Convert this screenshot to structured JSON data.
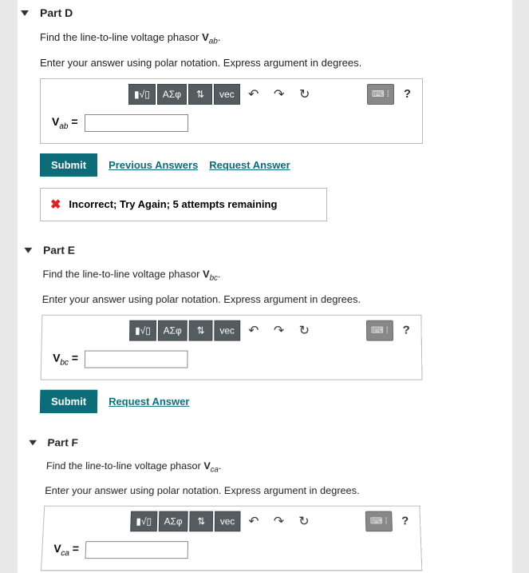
{
  "parts": {
    "d": {
      "title": "Part D",
      "prompt_pre": "Find the line-to-line voltage phasor ",
      "var_bold": "V",
      "var_sub": "ab",
      "prompt_post": ".",
      "instruction": "Enter your answer using polar notation. Express argument in degrees.",
      "label_pre": "V",
      "label_sub": "ab",
      "eq": " =",
      "submit": "Submit",
      "prev": "Previous Answers",
      "req": "Request Answer",
      "feedback": "Incorrect; Try Again; 5 attempts remaining"
    },
    "e": {
      "title": "Part E",
      "prompt_pre": "Find the line-to-line voltage phasor ",
      "var_bold": "V",
      "var_sub": "bc",
      "prompt_post": ".",
      "instruction": "Enter your answer using polar notation. Express argument in degrees.",
      "label_pre": "V",
      "label_sub": "bc",
      "eq": " =",
      "submit": "Submit",
      "req": "Request Answer"
    },
    "f": {
      "title": "Part F",
      "prompt_pre": "Find the line-to-line voltage phasor ",
      "var_bold": "V",
      "var_sub": "ca",
      "prompt_post": ".",
      "instruction": "Enter your answer using polar notation. Express argument in degrees.",
      "label_pre": "V",
      "label_sub": "ca",
      "eq": " ="
    }
  },
  "toolbar": {
    "template": "▮√▯",
    "greek": "ΑΣφ",
    "frac": "⇅",
    "vec": "vec",
    "undo": "↶",
    "redo": "↷",
    "reset": "↻",
    "keyboard": "⌨ ⁞",
    "help": "?"
  }
}
